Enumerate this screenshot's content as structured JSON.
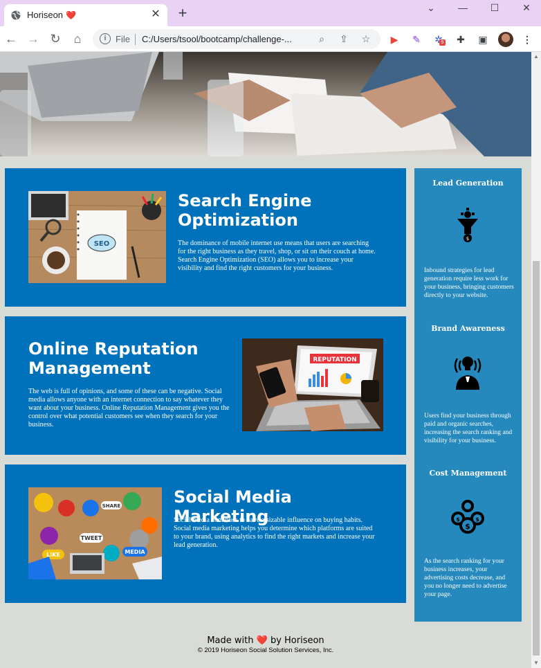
{
  "browser": {
    "tab_title": "Horiseon",
    "tab_emoji": "❤️",
    "omnibox_scheme": "File",
    "omnibox_url": "C:/Users/tsool/bootcamp/challenge-...",
    "extension_badge": "9"
  },
  "sections": [
    {
      "title": "Search Engine Optimization",
      "text": "The dominance of mobile internet use means that users are searching for the right business as they travel, shop, or sit on their couch at home. Search Engine Optimization (SEO) allows you to increase your visibility and find the right customers for your business."
    },
    {
      "title": "Online Reputation Management",
      "text": "The web is full of opinions, and some of these can be negative. Social media allows anyone with an internet connection to say whatever they want about your business. Online Reputation Management gives you the control over what potential customers see when they search for your business."
    },
    {
      "title": "Social Media Marketing",
      "text": "Social media continues to have a sizable influence on buying habits. Social media marketing helps you determine which platforms are suited to your brand, using analytics to find the right markets and increase your lead generation."
    }
  ],
  "benefits": [
    {
      "title": "Lead Generation",
      "text": "Inbound strategies for lead generation require less work for your business, bringing customers directly to your website."
    },
    {
      "title": "Brand Awareness",
      "text": "Users find your business through paid and organic searches, increasing the search ranking and visibility for your business."
    },
    {
      "title": "Cost Management",
      "text": "As the search ranking for your business increases, your advertising costs decrease, and you no longer need to advertise your page."
    }
  ],
  "footer": {
    "made_with": "Made with",
    "heart": "❤️",
    "by": "by Horiseon",
    "copyright": "© 2019 Horiseon Social Solution Services, Inc."
  },
  "image_labels": {
    "seo": "SEO",
    "reputation": "REPUTATION",
    "share": "SHARE",
    "tweet": "TWEET",
    "like": "LIKE",
    "media": "MEDIA"
  },
  "colors": {
    "section_bg": "#0072bb",
    "aside_bg": "#2589bd",
    "page_bg": "#d9dcd6"
  }
}
